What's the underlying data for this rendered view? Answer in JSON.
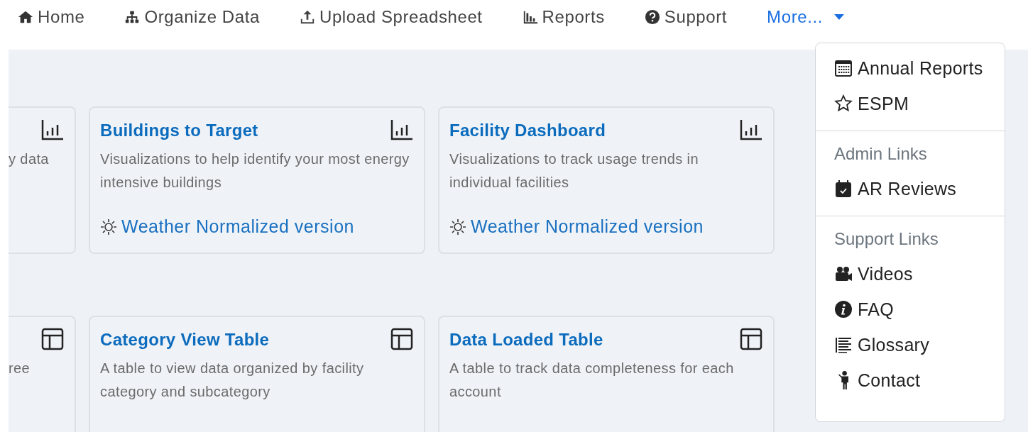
{
  "nav": [
    {
      "label": "Home"
    },
    {
      "label": "Organize Data"
    },
    {
      "label": "Upload Spreadsheet"
    },
    {
      "label": "Reports"
    },
    {
      "label": "Support"
    },
    {
      "label": "More...",
      "kind": "dropdown",
      "expanded": true
    }
  ],
  "card_rows": [
    {
      "cards": [
        {
          "kind": "chart",
          "partial": true,
          "description": "y data"
        },
        {
          "kind": "chart",
          "title": "Buildings to Target",
          "description": "Visualizations to help identify your most energy intensive buildings",
          "link": "Weather Normalized version"
        },
        {
          "kind": "chart",
          "title": "Facility Dashboard",
          "description": "Visualizations to track usage trends in individual facilities",
          "link": "Weather Normalized version"
        }
      ]
    },
    {
      "cards": [
        {
          "kind": "table",
          "partial": true,
          "description": "ree"
        },
        {
          "kind": "table",
          "title": "Category View Table",
          "description": "A table to view data organized by facility category and subcategory"
        },
        {
          "kind": "table",
          "title": "Data Loaded Table",
          "description": "A table to track data completeness for each account"
        }
      ]
    }
  ],
  "dropdown": {
    "items": [
      {
        "kind": "link",
        "label": "Annual Reports"
      },
      {
        "kind": "link",
        "label": "ESPM"
      },
      {
        "kind": "divider"
      },
      {
        "kind": "header",
        "label": "Admin Links"
      },
      {
        "kind": "link",
        "label": "AR Reviews"
      },
      {
        "kind": "divider"
      },
      {
        "kind": "header",
        "label": "Support Links"
      },
      {
        "kind": "link",
        "label": "Videos"
      },
      {
        "kind": "link",
        "label": "FAQ"
      },
      {
        "kind": "link",
        "label": "Glossary"
      },
      {
        "kind": "link",
        "label": "Contact"
      }
    ]
  }
}
